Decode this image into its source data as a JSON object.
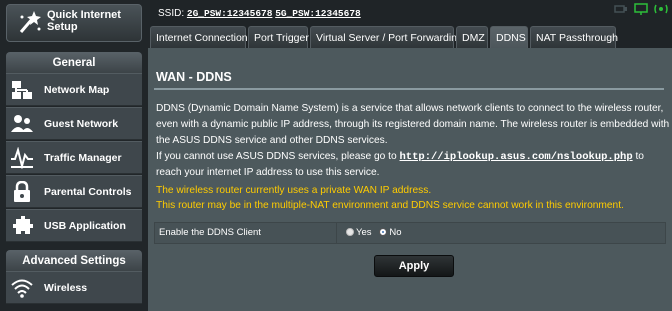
{
  "sidebar": {
    "quick_setup": {
      "label": "Quick Internet Setup",
      "icon": "wand-icon"
    },
    "general_header": "General",
    "general_items": [
      {
        "label": "Network Map",
        "icon": "network-map-icon"
      },
      {
        "label": "Guest Network",
        "icon": "guest-network-icon"
      },
      {
        "label": "Traffic Manager",
        "icon": "traffic-manager-icon"
      },
      {
        "label": "Parental Controls",
        "icon": "lock-icon"
      },
      {
        "label": "USB Application",
        "icon": "usb-application-icon"
      }
    ],
    "advanced_header": "Advanced Settings",
    "advanced_items": [
      {
        "label": "Wireless",
        "icon": "wifi-icon"
      }
    ]
  },
  "header": {
    "ssid_prefix": "SSID:",
    "ssid_2g": "2G_PSW:12345678",
    "ssid_5g": "5G_PSW:12345678"
  },
  "tabs": [
    {
      "label": "Internet Connection",
      "active": false
    },
    {
      "label": "Port Trigger",
      "active": false
    },
    {
      "label": "Virtual Server / Port Forwarding",
      "active": false
    },
    {
      "label": "DMZ",
      "active": false
    },
    {
      "label": "DDNS",
      "active": true
    },
    {
      "label": "NAT Passthrough",
      "active": false
    }
  ],
  "page": {
    "title": "WAN - DDNS",
    "description_1": "DDNS (Dynamic Domain Name System) is a service that allows network clients to connect to the wireless router, even with a dynamic public IP address, through its registered domain name. The wireless router is embedded with the ASUS DDNS service and other DDNS services.",
    "description_2_before": "If you cannot use ASUS DDNS services, please go to ",
    "description_2_link": "http://iplookup.asus.com/nslookup.php",
    "description_2_after": " to reach your internet IP address to use this service.",
    "warning_1": "The wireless router currently uses a private WAN IP address.",
    "warning_2": "This router may be in the multiple-NAT environment and DDNS service cannot work in this environment.",
    "enable_label": "Enable the DDNS Client",
    "option_yes": "Yes",
    "option_no": "No",
    "selected_option": "No",
    "apply_label": "Apply"
  },
  "colors": {
    "warning_text": "#ffcc00",
    "content_bg": "#4d595d",
    "sidebar_bg": "#212629"
  }
}
